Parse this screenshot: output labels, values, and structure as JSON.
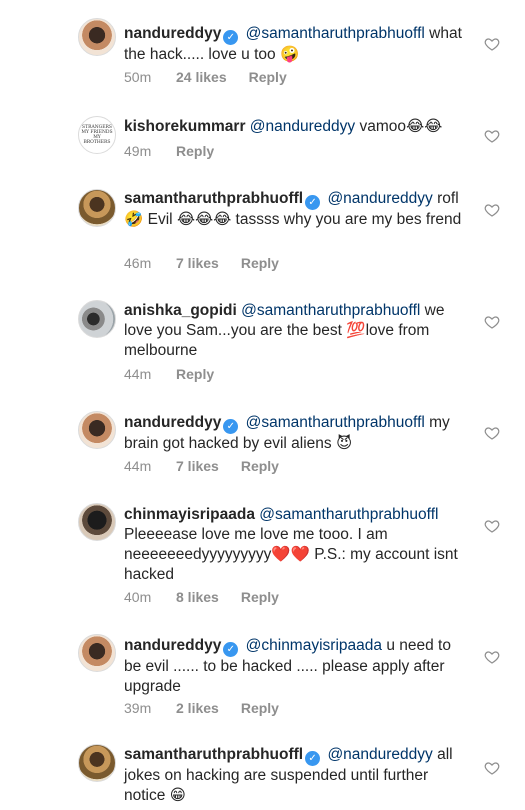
{
  "comments": [
    {
      "username": "nandureddyy",
      "verified": true,
      "mention": "@samantharuthprabhuoffl",
      "text": "what the hack..... love u too 🤪",
      "time": "50m",
      "likes": "24 likes",
      "reply": "Reply"
    },
    {
      "username": "kishorekummarr",
      "verified": false,
      "mention": "@nandureddyy",
      "text": "vamoo😂😂",
      "time": "49m",
      "likes": "",
      "reply": "Reply",
      "avatar_text": [
        "STRANGERS",
        "MY FRIENDS",
        "MY BROTHERS"
      ]
    },
    {
      "username": "samantharuthprabhuoffl",
      "verified": true,
      "mention": "@nandureddyy",
      "text": "rofl 🤣 Evil 😂😂😂 tassss why you are my bes frend",
      "time": "46m",
      "likes": "7 likes",
      "reply": "Reply"
    },
    {
      "username": "anishka_gopidi",
      "verified": false,
      "mention": "@samantharuthprabhuoffl",
      "text": "we love you Sam...you are the best 💯love from melbourne",
      "time": "44m",
      "likes": "",
      "reply": "Reply"
    },
    {
      "username": "nandureddyy",
      "verified": true,
      "mention": "@samantharuthprabhuoffl",
      "text": "my brain got hacked by evil aliens 😈",
      "time": "44m",
      "likes": "7 likes",
      "reply": "Reply"
    },
    {
      "username": "chinmayisripaada",
      "verified": false,
      "mention": "@samantharuthprabhuoffl",
      "text": "Pleeeease love me love me tooo. I am neeeeeeedyyyyyyyyy❤️❤️ P.S.: my account isnt hacked",
      "time": "40m",
      "likes": "8 likes",
      "reply": "Reply"
    },
    {
      "username": "nandureddyy",
      "verified": true,
      "mention": "@chinmayisripaada",
      "text": "u need to be evil ...... to be hacked ..... please apply after upgrade",
      "time": "39m",
      "likes": "2 likes",
      "reply": "Reply"
    },
    {
      "username": "samantharuthprabhuoffl",
      "verified": true,
      "mention": "@nandureddyy",
      "text": "all jokes on hacking are suspended until further notice 😁",
      "time": "",
      "likes": "",
      "reply": ""
    }
  ],
  "icons": {
    "like": "heart-outline-icon",
    "verified": "verified-badge-icon"
  },
  "colors": {
    "mention": "#003569",
    "verified": "#3897f0",
    "meta": "#8e8e8e"
  }
}
